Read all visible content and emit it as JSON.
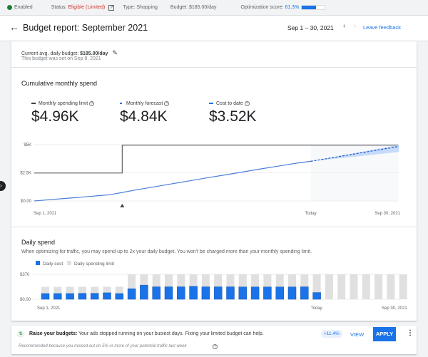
{
  "topbar": {
    "enabled": "Enabled",
    "status_label": "Status:",
    "status_value": "Eligible (Limited)",
    "type": "Type: Shopping",
    "budget": "Budget: $185.00/day",
    "opt_label": "Optimization score:",
    "opt_value": "61.3%",
    "opt_fraction": 0.613
  },
  "header": {
    "title": "Budget report: September 2021",
    "date_range": "Sep 1 – 30, 2021",
    "feedback": "Leave feedback"
  },
  "budget_info": {
    "label": "Current avg. daily budget:",
    "value": "$185.00/day",
    "set_on": "This budget was set on Sep 8, 2021"
  },
  "cumulative": {
    "title": "Cumulative monthly spend",
    "metrics": [
      {
        "label": "Monthly spending limit",
        "value": "$4.96K",
        "color": "#3c4043"
      },
      {
        "label": "Monthly forecast",
        "value": "$4.84K",
        "color": "#1a73e8"
      },
      {
        "label": "Cost to date",
        "value": "$3.52K",
        "color": "#1a73e8"
      }
    ]
  },
  "daily": {
    "title": "Daily spend",
    "note": "When optimizing for traffic, you may spend up to 2x your daily budget. You won't be charged more than your monthly spending limit."
  },
  "chart_data": [
    {
      "type": "line",
      "x_tick_labels": [
        "Sep 1, 2021",
        "Today",
        "Sep 30, 2021"
      ],
      "y_tick_labels": [
        "$5K",
        "$2.5K",
        "$0.00"
      ],
      "ylim": [
        0,
        5000
      ],
      "today_day": 23,
      "budget_change_day": 8,
      "series": [
        {
          "name": "Monthly spending limit",
          "x": [
            1,
            8,
            8,
            30
          ],
          "values": [
            2480,
            2480,
            4960,
            4960
          ]
        },
        {
          "name": "Cost to date",
          "x": [
            1,
            2,
            3,
            4,
            5,
            6,
            7,
            8,
            9,
            10,
            11,
            12,
            13,
            14,
            15,
            16,
            17,
            18,
            19,
            20,
            21,
            22,
            23
          ],
          "values": [
            0,
            90,
            180,
            270,
            360,
            460,
            550,
            750,
            960,
            1150,
            1340,
            1530,
            1720,
            1910,
            2100,
            2280,
            2460,
            2650,
            2840,
            3020,
            3200,
            3380,
            3520
          ]
        },
        {
          "name": "Monthly forecast",
          "x": [
            23,
            30
          ],
          "values": [
            3520,
            4840
          ],
          "band_low": [
            3520,
            4350
          ],
          "band_high": [
            3520,
            4980
          ]
        }
      ]
    },
    {
      "type": "bar",
      "legend": [
        "Daily cost",
        "Daily spending limit"
      ],
      "x_tick_labels": [
        "Sep 1, 2021",
        "Today",
        "Sep 30, 2021"
      ],
      "y_tick_labels": [
        "$370",
        "$0.00"
      ],
      "ylim": [
        0,
        370
      ],
      "days": [
        1,
        2,
        3,
        4,
        5,
        6,
        7,
        8,
        9,
        10,
        11,
        12,
        13,
        14,
        15,
        16,
        17,
        18,
        19,
        20,
        21,
        22,
        23,
        24,
        25,
        26,
        27,
        28,
        29,
        30
      ],
      "series": [
        {
          "name": "Daily cost",
          "values": [
            85,
            85,
            85,
            88,
            88,
            96,
            85,
            157,
            210,
            185,
            185,
            185,
            192,
            185,
            185,
            185,
            183,
            183,
            183,
            183,
            183,
            185,
            100,
            null,
            null,
            null,
            null,
            null,
            null,
            null
          ]
        },
        {
          "name": "Daily spending limit",
          "values": [
            185,
            185,
            185,
            185,
            185,
            185,
            185,
            370,
            370,
            370,
            370,
            370,
            370,
            370,
            370,
            370,
            370,
            370,
            370,
            370,
            370,
            370,
            370,
            370,
            370,
            370,
            370,
            370,
            370,
            370
          ]
        }
      ]
    }
  ],
  "recommendation": {
    "title": "Raise your budgets:",
    "text": "Your ads stopped running on your busiest days. Fixing your limited budget can help.",
    "uplift": "+11.4%",
    "view": "VIEW",
    "apply": "APPLY",
    "reason": "Recommended because you missed out on 5% or more of your potential traffic last week"
  },
  "colors": {
    "accent": "#1a73e8",
    "limited": "#d93025",
    "limit_line": "#5f6368",
    "bar_limit": "#e0e0e0"
  }
}
